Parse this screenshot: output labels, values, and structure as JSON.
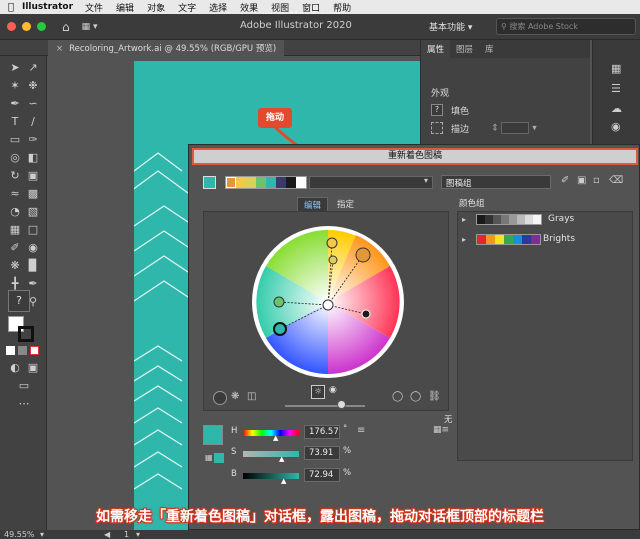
{
  "menubar": {
    "app_name": "Illustrator",
    "items": [
      "文件",
      "编辑",
      "对象",
      "文字",
      "选择",
      "效果",
      "视图",
      "窗口",
      "帮助"
    ]
  },
  "appbar": {
    "title": "Adobe Illustrator 2020",
    "workspace": "基本功能",
    "stock_placeholder": "搜索 Adobe Stock",
    "traffic_colors": [
      "#ff5f57",
      "#febc2e",
      "#28c840"
    ]
  },
  "document_tab": {
    "close": "×",
    "label": "Recoloring_Artwork.ai @ 49.55% (RGB/GPU 预览)"
  },
  "status": {
    "zoom": "49.55%",
    "page": "1"
  },
  "right_panel": {
    "tabs": [
      "属性",
      "图层",
      "库"
    ],
    "appearance_label": "外观",
    "fill_label": "填色",
    "stroke_label": "描边"
  },
  "annotation": {
    "drag_tag": "拖动",
    "color": "#e24a2f"
  },
  "dialog": {
    "title": "重新着色图稿",
    "artwork_group_label": "图稿组",
    "mode_tabs": [
      "编辑",
      "指定"
    ],
    "color_groups_label": "颜色组",
    "groups": [
      {
        "name": "Grays",
        "swatches": [
          "#1a1a1a",
          "#333333",
          "#555555",
          "#777777",
          "#999999",
          "#bbbbbb",
          "#dddddd",
          "#f5f5f5"
        ]
      },
      {
        "name": "Brights",
        "swatches": [
          "#e5252a",
          "#f39a1e",
          "#f7e21b",
          "#35a853",
          "#1a8fd6",
          "#2b3a9a",
          "#7b2f95"
        ]
      }
    ],
    "current_swatches": [
      "#e6963a",
      "#f2c84b",
      "#d8d05a",
      "#6ec26e",
      "#2fb7ac",
      "#3a3a6a",
      "#1b1b1b",
      "#ffffff"
    ],
    "active_swatch": "#2fb7ac",
    "h_label": "H",
    "h_value": "176.57",
    "h_unit": "°",
    "s_label": "S",
    "s_value": "73.91",
    "s_unit": "%",
    "b_label": "B",
    "b_value": "72.94",
    "b_unit": "%",
    "none_label": "无"
  },
  "caption": "如需移走「重新着色图稿」对话框，露出图稿，拖动对话框顶部的标题栏",
  "watermark": "www.MacZ.com"
}
